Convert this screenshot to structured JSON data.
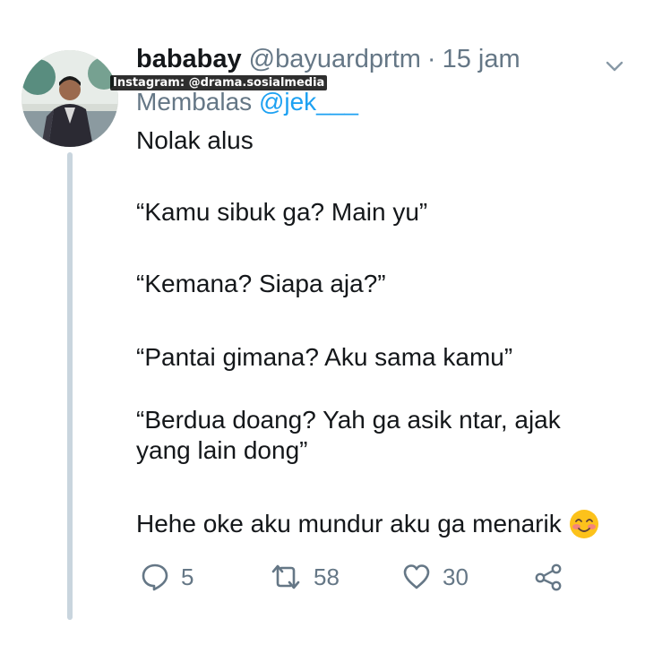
{
  "tweet": {
    "display_name": "bababay",
    "handle": "@bayuardprtm",
    "separator": "·",
    "time": "15 jam",
    "reply_prefix": "Membalas",
    "reply_mention": "@jek___",
    "lines": [
      "Nolak alus",
      "“Kamu sibuk ga? Main yu”",
      "“Kemana? Siapa aja?”",
      "“Pantai gimana? Aku sama kamu”",
      "“Berdua doang? Yah ga asik ntar, ajak yang lain dong”",
      "Hehe oke aku mundur aku ga menarik"
    ],
    "emoji": "smiling-face-with-blush"
  },
  "watermark": "Instagram: @drama.sosialmedia",
  "actions": {
    "reply_count": "5",
    "retweet_count": "58",
    "like_count": "30"
  },
  "colors": {
    "text": "#14171a",
    "secondary": "#657786",
    "mention": "#1da1f2",
    "thread_line": "#c9d5de"
  }
}
